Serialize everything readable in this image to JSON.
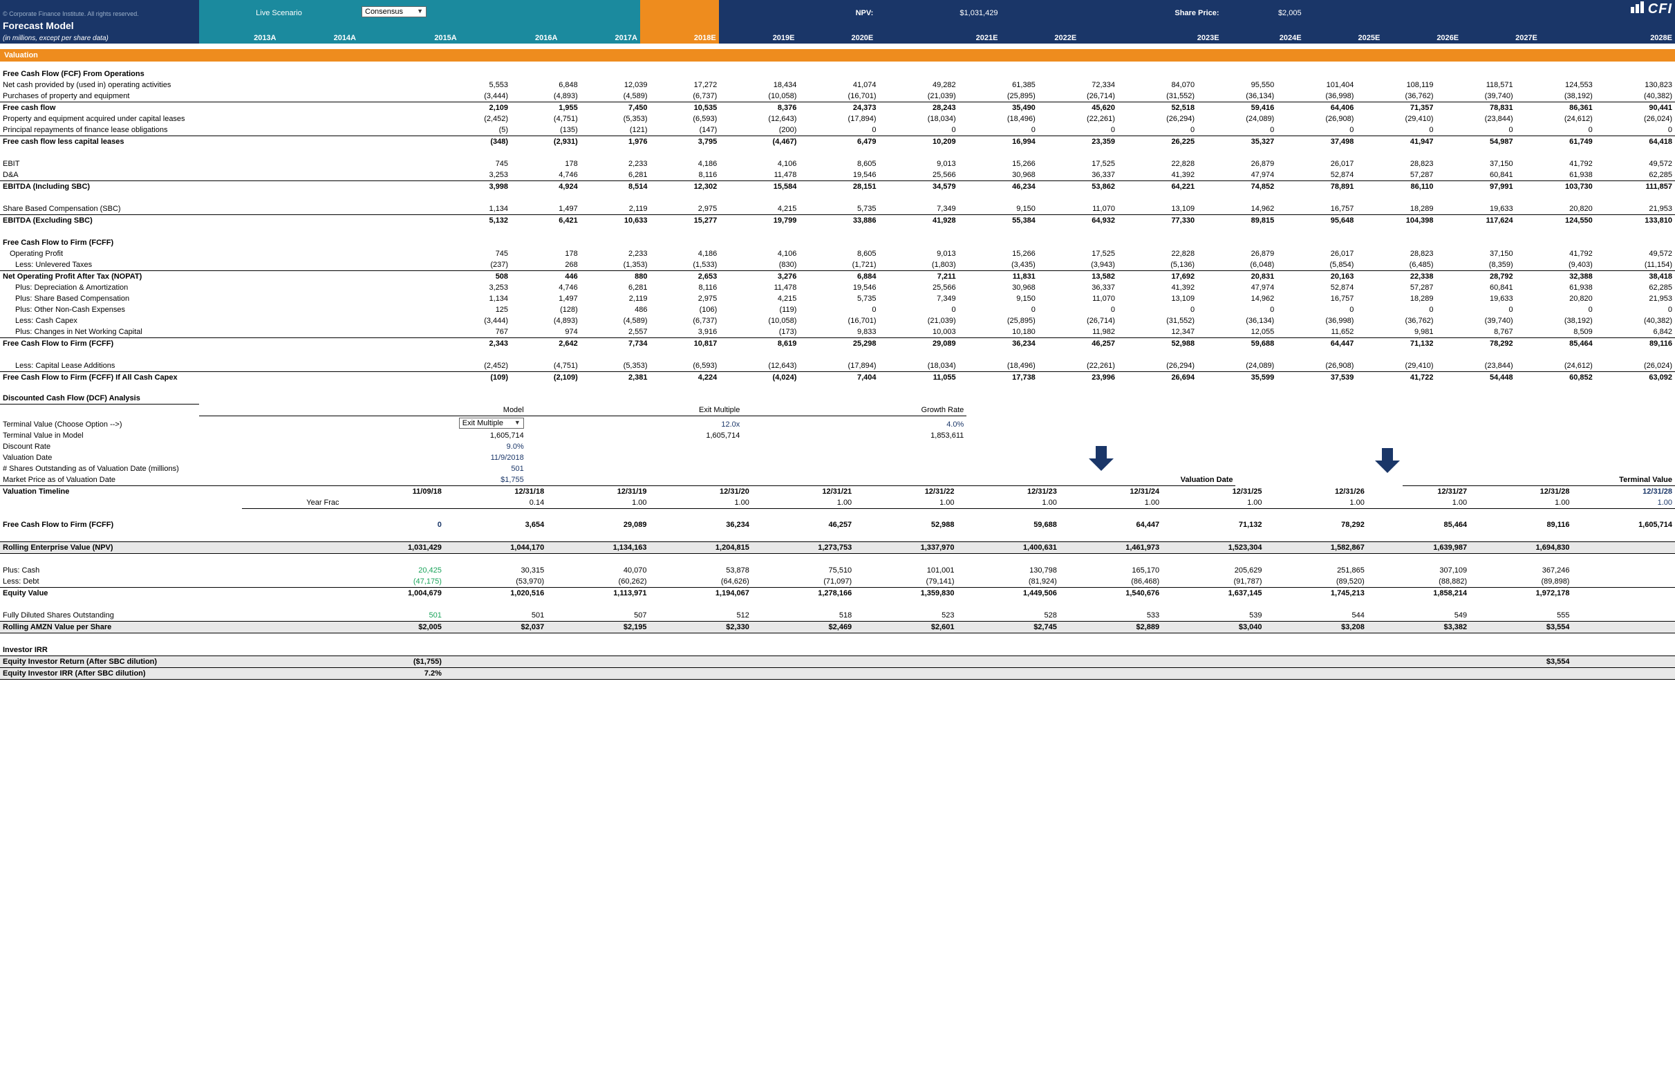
{
  "header": {
    "copyright": "© Corporate Finance Institute. All rights reserved.",
    "title": "Forecast Model",
    "subtitle": "(in millions, except per share data)",
    "live_scenario_lbl": "Live Scenario",
    "scenario_value": "Consensus",
    "npv_lbl": "NPV:",
    "npv_val": "$1,031,429",
    "share_lbl": "Share Price:",
    "share_val": "$2,005",
    "logo": "CFI",
    "years": [
      "2013A",
      "2014A",
      "2015A",
      "2016A",
      "2017A",
      "2018E",
      "2019E",
      "2020E",
      "2021E",
      "2022E",
      "2023E",
      "2024E",
      "2025E",
      "2026E",
      "2027E",
      "2028E"
    ]
  },
  "sections": {
    "valuation": "Valuation",
    "fcf_ops": "Free Cash Flow (FCF) From Operations",
    "fcff_hdr": "Free Cash Flow to Firm (FCFF)",
    "dcf_hdr": "Discounted Cash Flow (DCF) Analysis",
    "val_timeline": "Valuation Timeline",
    "inv_irr": "Investor IRR"
  },
  "rows": {
    "ncpo": {
      "l": "Net cash provided by (used in) operating activities",
      "v": [
        "5,553",
        "6,848",
        "12,039",
        "17,272",
        "18,434",
        "41,074",
        "49,282",
        "61,385",
        "72,334",
        "84,070",
        "95,550",
        "101,404",
        "108,119",
        "118,571",
        "124,553",
        "130,823"
      ]
    },
    "ppe": {
      "l": "Purchases of property and equipment",
      "v": [
        "(3,444)",
        "(4,893)",
        "(4,589)",
        "(6,737)",
        "(10,058)",
        "(16,701)",
        "(21,039)",
        "(25,895)",
        "(26,714)",
        "(31,552)",
        "(36,134)",
        "(36,998)",
        "(36,762)",
        "(39,740)",
        "(38,192)",
        "(40,382)"
      ]
    },
    "fcf": {
      "l": "Free cash flow",
      "v": [
        "2,109",
        "1,955",
        "7,450",
        "10,535",
        "8,376",
        "24,373",
        "28,243",
        "35,490",
        "45,620",
        "52,518",
        "59,416",
        "64,406",
        "71,357",
        "78,831",
        "86,361",
        "90,441"
      ]
    },
    "pecl": {
      "l": "Property and equipment acquired under capital leases",
      "v": [
        "(2,452)",
        "(4,751)",
        "(5,353)",
        "(6,593)",
        "(12,643)",
        "(17,894)",
        "(18,034)",
        "(18,496)",
        "(22,261)",
        "(26,294)",
        "(24,089)",
        "(26,908)",
        "(29,410)",
        "(23,844)",
        "(24,612)",
        "(26,024)"
      ]
    },
    "prin": {
      "l": "Principal repayments of finance lease obligations",
      "v": [
        "(5)",
        "(135)",
        "(121)",
        "(147)",
        "(200)",
        "0",
        "0",
        "0",
        "0",
        "0",
        "0",
        "0",
        "0",
        "0",
        "0",
        "0"
      ]
    },
    "fcfcl": {
      "l": "Free cash flow less capital leases",
      "v": [
        "(348)",
        "(2,931)",
        "1,976",
        "3,795",
        "(4,467)",
        "6,479",
        "10,209",
        "16,994",
        "23,359",
        "26,225",
        "35,327",
        "37,498",
        "41,947",
        "54,987",
        "61,749",
        "64,418"
      ]
    },
    "ebit": {
      "l": "EBIT",
      "v": [
        "745",
        "178",
        "2,233",
        "4,186",
        "4,106",
        "8,605",
        "9,013",
        "15,266",
        "17,525",
        "22,828",
        "26,879",
        "26,017",
        "28,823",
        "37,150",
        "41,792",
        "49,572"
      ]
    },
    "da": {
      "l": "D&A",
      "v": [
        "3,253",
        "4,746",
        "6,281",
        "8,116",
        "11,478",
        "19,546",
        "25,566",
        "30,968",
        "36,337",
        "41,392",
        "47,974",
        "52,874",
        "57,287",
        "60,841",
        "61,938",
        "62,285"
      ]
    },
    "ebitda_inc": {
      "l": "EBITDA (Including SBC)",
      "v": [
        "3,998",
        "4,924",
        "8,514",
        "12,302",
        "15,584",
        "28,151",
        "34,579",
        "46,234",
        "53,862",
        "64,221",
        "74,852",
        "78,891",
        "86,110",
        "97,991",
        "103,730",
        "111,857"
      ]
    },
    "sbc": {
      "l": "Share Based Compensation (SBC)",
      "v": [
        "1,134",
        "1,497",
        "2,119",
        "2,975",
        "4,215",
        "5,735",
        "7,349",
        "9,150",
        "11,070",
        "13,109",
        "14,962",
        "16,757",
        "18,289",
        "19,633",
        "20,820",
        "21,953"
      ]
    },
    "ebitda_ex": {
      "l": "EBITDA (Excluding SBC)",
      "v": [
        "5,132",
        "6,421",
        "10,633",
        "15,277",
        "19,799",
        "33,886",
        "41,928",
        "55,384",
        "64,932",
        "77,330",
        "89,815",
        "95,648",
        "104,398",
        "117,624",
        "124,550",
        "133,810"
      ]
    },
    "op": {
      "l": "Operating Profit",
      "v": [
        "745",
        "178",
        "2,233",
        "4,186",
        "4,106",
        "8,605",
        "9,013",
        "15,266",
        "17,525",
        "22,828",
        "26,879",
        "26,017",
        "28,823",
        "37,150",
        "41,792",
        "49,572"
      ]
    },
    "ultax": {
      "l": "Less: Unlevered Taxes",
      "v": [
        "(237)",
        "268",
        "(1,353)",
        "(1,533)",
        "(830)",
        "(1,721)",
        "(1,803)",
        "(3,435)",
        "(3,943)",
        "(5,136)",
        "(6,048)",
        "(5,854)",
        "(6,485)",
        "(8,359)",
        "(9,403)",
        "(11,154)"
      ]
    },
    "nopat": {
      "l": "Net Operating Profit After Tax (NOPAT)",
      "v": [
        "508",
        "446",
        "880",
        "2,653",
        "3,276",
        "6,884",
        "7,211",
        "11,831",
        "13,582",
        "17,692",
        "20,831",
        "20,163",
        "22,338",
        "28,792",
        "32,388",
        "38,418"
      ]
    },
    "pda": {
      "l": "Plus: Depreciation & Amortization",
      "v": [
        "3,253",
        "4,746",
        "6,281",
        "8,116",
        "11,478",
        "19,546",
        "25,566",
        "30,968",
        "36,337",
        "41,392",
        "47,974",
        "52,874",
        "57,287",
        "60,841",
        "61,938",
        "62,285"
      ]
    },
    "psbc": {
      "l": "Plus: Share Based Compensation",
      "v": [
        "1,134",
        "1,497",
        "2,119",
        "2,975",
        "4,215",
        "5,735",
        "7,349",
        "9,150",
        "11,070",
        "13,109",
        "14,962",
        "16,757",
        "18,289",
        "19,633",
        "20,820",
        "21,953"
      ]
    },
    "ponc": {
      "l": "Plus: Other Non-Cash Expenses",
      "v": [
        "125",
        "(128)",
        "486",
        "(106)",
        "(119)",
        "0",
        "0",
        "0",
        "0",
        "0",
        "0",
        "0",
        "0",
        "0",
        "0",
        "0"
      ]
    },
    "lcapex": {
      "l": "Less: Cash Capex",
      "v": [
        "(3,444)",
        "(4,893)",
        "(4,589)",
        "(6,737)",
        "(10,058)",
        "(16,701)",
        "(21,039)",
        "(25,895)",
        "(26,714)",
        "(31,552)",
        "(36,134)",
        "(36,998)",
        "(36,762)",
        "(39,740)",
        "(38,192)",
        "(40,382)"
      ]
    },
    "pnwc": {
      "l": "Plus: Changes in Net Working Capital",
      "v": [
        "767",
        "974",
        "2,557",
        "3,916",
        "(173)",
        "9,833",
        "10,003",
        "10,180",
        "11,982",
        "12,347",
        "12,055",
        "11,652",
        "9,981",
        "8,767",
        "8,509",
        "6,842"
      ]
    },
    "fcff": {
      "l": "Free Cash Flow to Firm (FCFF)",
      "v": [
        "2,343",
        "2,642",
        "7,734",
        "10,817",
        "8,619",
        "25,298",
        "29,089",
        "36,234",
        "46,257",
        "52,988",
        "59,688",
        "64,447",
        "71,132",
        "78,292",
        "85,464",
        "89,116"
      ]
    },
    "lcla": {
      "l": "Less: Capital Lease Additions",
      "v": [
        "(2,452)",
        "(4,751)",
        "(5,353)",
        "(6,593)",
        "(12,643)",
        "(17,894)",
        "(18,034)",
        "(18,496)",
        "(22,261)",
        "(26,294)",
        "(24,089)",
        "(26,908)",
        "(29,410)",
        "(23,844)",
        "(24,612)",
        "(26,024)"
      ]
    },
    "fcffac": {
      "l": "Free Cash Flow to Firm (FCFF) If All Cash Capex",
      "v": [
        "(109)",
        "(2,109)",
        "2,381",
        "4,224",
        "(4,024)",
        "7,404",
        "11,055",
        "17,738",
        "23,996",
        "26,694",
        "35,599",
        "37,539",
        "41,722",
        "54,448",
        "60,852",
        "63,092"
      ]
    }
  },
  "dcf": {
    "hdr": [
      "Model",
      "Exit Multiple",
      "Growth Rate"
    ],
    "tv_lbl": "Terminal Value (Choose Option -->)",
    "tv_v": [
      "Exit Multiple",
      "12.0x",
      "4.0%"
    ],
    "tvm_lbl": "Terminal Value in Model",
    "tvm_v": [
      "1,605,714",
      "1,605,714",
      "1,853,611"
    ],
    "dr_lbl": "Discount Rate",
    "dr_v": "9.0%",
    "vd_lbl": "Valuation Date",
    "vd_v": "11/9/2018",
    "sh_lbl": "# Shares Outstanding as of Valuation Date (millions)",
    "sh_v": "501",
    "mp_lbl": "Market Price as of Valuation Date",
    "mp_v": "$1,755",
    "arrow1": "Valuation Date",
    "arrow2": "Terminal Value"
  },
  "timeline": {
    "dates_lbl": "",
    "dates": [
      "11/09/18",
      "12/31/18",
      "12/31/19",
      "12/31/20",
      "12/31/21",
      "12/31/22",
      "12/31/23",
      "12/31/24",
      "12/31/25",
      "12/31/26",
      "12/31/27",
      "12/31/28",
      "12/31/28"
    ],
    "yf_lbl": "Year Frac",
    "yf": [
      "",
      "0.14",
      "1.00",
      "1.00",
      "1.00",
      "1.00",
      "1.00",
      "1.00",
      "1.00",
      "1.00",
      "1.00",
      "1.00",
      "1.00"
    ],
    "fcff_lbl": "Free Cash Flow to Firm (FCFF)",
    "fcff": [
      "0",
      "3,654",
      "29,089",
      "36,234",
      "46,257",
      "52,988",
      "59,688",
      "64,447",
      "71,132",
      "78,292",
      "85,464",
      "89,116",
      "1,605,714"
    ],
    "rev_lbl": "Rolling Enterprise Value (NPV)",
    "rev": [
      "1,031,429",
      "1,044,170",
      "1,134,163",
      "1,204,815",
      "1,273,753",
      "1,337,970",
      "1,400,631",
      "1,461,973",
      "1,523,304",
      "1,582,867",
      "1,639,987",
      "1,694,830",
      ""
    ],
    "cash_lbl": "Plus: Cash",
    "cash": [
      "20,425",
      "30,315",
      "40,070",
      "53,878",
      "75,510",
      "101,001",
      "130,798",
      "165,170",
      "205,629",
      "251,865",
      "307,109",
      "367,246",
      ""
    ],
    "debt_lbl": "Less: Debt",
    "debt": [
      "(47,175)",
      "(53,970)",
      "(60,262)",
      "(64,626)",
      "(71,097)",
      "(79,141)",
      "(81,924)",
      "(86,468)",
      "(91,787)",
      "(89,520)",
      "(88,882)",
      "(89,898)",
      ""
    ],
    "eq_lbl": "Equity Value",
    "eq": [
      "1,004,679",
      "1,020,516",
      "1,113,971",
      "1,194,067",
      "1,278,166",
      "1,359,830",
      "1,449,506",
      "1,540,676",
      "1,637,145",
      "1,745,213",
      "1,858,214",
      "1,972,178",
      ""
    ],
    "fds_lbl": "Fully Diluted Shares Outstanding",
    "fds": [
      "501",
      "501",
      "507",
      "512",
      "518",
      "523",
      "528",
      "533",
      "539",
      "544",
      "549",
      "555",
      ""
    ],
    "rav_lbl": "Rolling AMZN Value per Share",
    "rav": [
      "$2,005",
      "$2,037",
      "$2,195",
      "$2,330",
      "$2,469",
      "$2,601",
      "$2,745",
      "$2,889",
      "$3,040",
      "$3,208",
      "$3,382",
      "$3,554",
      ""
    ]
  },
  "irr": {
    "ret_lbl": "Equity Investor Return (After SBC dilution)",
    "ret_a": "($1,755)",
    "ret_b": "$3,554",
    "irr_lbl": "Equity Investor IRR (After SBC dilution)",
    "irr_v": "7.2%"
  }
}
